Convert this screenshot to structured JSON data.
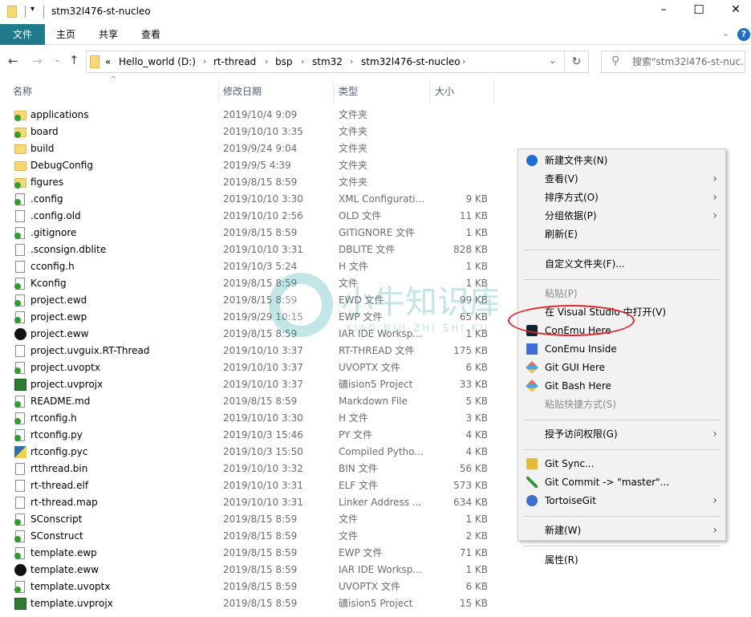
{
  "window": {
    "title": "stm32l476-st-nucleo",
    "minimize": "–",
    "maximize": "☐",
    "close": "✕"
  },
  "ribbon": {
    "tabs": [
      {
        "label": "文件",
        "active": true
      },
      {
        "label": "主页"
      },
      {
        "label": "共享"
      },
      {
        "label": "查看"
      }
    ],
    "accent": "#1f7a8c",
    "help": "?"
  },
  "address": {
    "overflow": "«",
    "crumbs": [
      "Hello_world (D:)",
      "rt-thread",
      "bsp",
      "stm32",
      "stm32l476-st-nucleo"
    ],
    "search_placeholder": "搜索\"stm32l476-st-nuc..."
  },
  "columns": {
    "name": "名称",
    "date": "修改日期",
    "type": "类型",
    "size": "大小"
  },
  "files": [
    {
      "name": "applications",
      "date": "2019/10/4 9:09",
      "type": "文件夹",
      "size": "",
      "icon": "folder-git"
    },
    {
      "name": "board",
      "date": "2019/10/10 3:35",
      "type": "文件夹",
      "size": "",
      "icon": "folder-git"
    },
    {
      "name": "build",
      "date": "2019/9/24 9:04",
      "type": "文件夹",
      "size": "",
      "icon": "folder"
    },
    {
      "name": "DebugConfig",
      "date": "2019/9/5 4:39",
      "type": "文件夹",
      "size": "",
      "icon": "folder"
    },
    {
      "name": "figures",
      "date": "2019/8/15 8:59",
      "type": "文件夹",
      "size": "",
      "icon": "folder-git"
    },
    {
      "name": ".config",
      "date": "2019/10/10 3:30",
      "type": "XML Configurati...",
      "size": "9 KB",
      "icon": "file-git"
    },
    {
      "name": ".config.old",
      "date": "2019/10/10 2:56",
      "type": "OLD 文件",
      "size": "11 KB",
      "icon": "file"
    },
    {
      "name": ".gitignore",
      "date": "2019/8/15 8:59",
      "type": "GITIGNORE 文件",
      "size": "1 KB",
      "icon": "file-git"
    },
    {
      "name": ".sconsign.dblite",
      "date": "2019/10/10 3:31",
      "type": "DBLITE 文件",
      "size": "828 KB",
      "icon": "file"
    },
    {
      "name": "cconfig.h",
      "date": "2019/10/3 5:24",
      "type": "H 文件",
      "size": "1 KB",
      "icon": "file"
    },
    {
      "name": "Kconfig",
      "date": "2019/8/15 8:59",
      "type": "文件",
      "size": "1 KB",
      "icon": "file-git"
    },
    {
      "name": "project.ewd",
      "date": "2019/8/15 8:59",
      "type": "EWD 文件",
      "size": "99 KB",
      "icon": "file-git"
    },
    {
      "name": "project.ewp",
      "date": "2019/9/29 10:15",
      "type": "EWP 文件",
      "size": "65 KB",
      "icon": "file-git"
    },
    {
      "name": "project.eww",
      "date": "2019/8/15 8:59",
      "type": "IAR IDE Worksp...",
      "size": "1 KB",
      "icon": "iar"
    },
    {
      "name": "project.uvguix.RT-Thread",
      "date": "2019/10/10 3:37",
      "type": "RT-THREAD 文件",
      "size": "175 KB",
      "icon": "file"
    },
    {
      "name": "project.uvoptx",
      "date": "2019/10/10 3:37",
      "type": "UVOPTX 文件",
      "size": "6 KB",
      "icon": "file-git"
    },
    {
      "name": "project.uvprojx",
      "date": "2019/10/10 3:37",
      "type": "礦ision5 Project",
      "size": "33 KB",
      "icon": "keil"
    },
    {
      "name": "README.md",
      "date": "2019/8/15 8:59",
      "type": "Markdown File",
      "size": "5 KB",
      "icon": "file-git"
    },
    {
      "name": "rtconfig.h",
      "date": "2019/10/10 3:30",
      "type": "H 文件",
      "size": "3 KB",
      "icon": "file-git"
    },
    {
      "name": "rtconfig.py",
      "date": "2019/10/3 15:46",
      "type": "PY 文件",
      "size": "4 KB",
      "icon": "file-git"
    },
    {
      "name": "rtconfig.pyc",
      "date": "2019/10/3 15:50",
      "type": "Compiled Pytho...",
      "size": "4 KB",
      "icon": "python"
    },
    {
      "name": "rtthread.bin",
      "date": "2019/10/10 3:32",
      "type": "BIN 文件",
      "size": "56 KB",
      "icon": "file"
    },
    {
      "name": "rt-thread.elf",
      "date": "2019/10/10 3:31",
      "type": "ELF 文件",
      "size": "573 KB",
      "icon": "file"
    },
    {
      "name": "rt-thread.map",
      "date": "2019/10/10 3:31",
      "type": "Linker Address ...",
      "size": "634 KB",
      "icon": "file"
    },
    {
      "name": "SConscript",
      "date": "2019/8/15 8:59",
      "type": "文件",
      "size": "1 KB",
      "icon": "file-git"
    },
    {
      "name": "SConstruct",
      "date": "2019/8/15 8:59",
      "type": "文件",
      "size": "2 KB",
      "icon": "file-git"
    },
    {
      "name": "template.ewp",
      "date": "2019/8/15 8:59",
      "type": "EWP 文件",
      "size": "71 KB",
      "icon": "file-git"
    },
    {
      "name": "template.eww",
      "date": "2019/8/15 8:59",
      "type": "IAR IDE Worksp...",
      "size": "1 KB",
      "icon": "iar"
    },
    {
      "name": "template.uvoptx",
      "date": "2019/8/15 8:59",
      "type": "UVOPTX 文件",
      "size": "6 KB",
      "icon": "file-git"
    },
    {
      "name": "template.uvprojx",
      "date": "2019/8/15 8:59",
      "type": "礦ision5 Project",
      "size": "15 KB",
      "icon": "keil"
    }
  ],
  "context_menu": {
    "items": [
      {
        "label": "新建文件夹(N)",
        "icon": "new-folder-icon"
      },
      {
        "label": "查看(V)",
        "submenu": true
      },
      {
        "label": "排序方式(O)",
        "submenu": true
      },
      {
        "label": "分组依据(P)",
        "submenu": true
      },
      {
        "label": "刷新(E)"
      },
      {
        "separator": true
      },
      {
        "label": "自定义文件夹(F)..."
      },
      {
        "separator": true
      },
      {
        "label": "粘贴(P)",
        "disabled": true
      },
      {
        "label": "在 Visual Studio 中打开(V)"
      },
      {
        "label": "ConEmu Here",
        "icon": "conemu-icon",
        "highlighted": true
      },
      {
        "label": "ConEmu Inside",
        "icon": "conemu-inside-icon"
      },
      {
        "label": "Git GUI Here",
        "icon": "git-icon"
      },
      {
        "label": "Git Bash Here",
        "icon": "git-icon"
      },
      {
        "label": "粘贴快捷方式(S)",
        "disabled": true
      },
      {
        "separator": true
      },
      {
        "label": "授予访问权限(G)",
        "submenu": true
      },
      {
        "separator": true
      },
      {
        "label": "Git Sync...",
        "icon": "git-sync-icon"
      },
      {
        "label": "Git Commit -> \"master\"...",
        "icon": "git-commit-icon"
      },
      {
        "label": "TortoiseGit",
        "icon": "tortoisegit-icon",
        "submenu": true
      },
      {
        "separator": true
      },
      {
        "label": "新建(W)",
        "submenu": true
      },
      {
        "separator": true
      },
      {
        "label": "属性(R)"
      }
    ],
    "highlight_color": "#e0262b"
  },
  "watermark": {
    "text": "小牛知识库",
    "subtext": "XIAO NIU ZHI SHI KU"
  }
}
